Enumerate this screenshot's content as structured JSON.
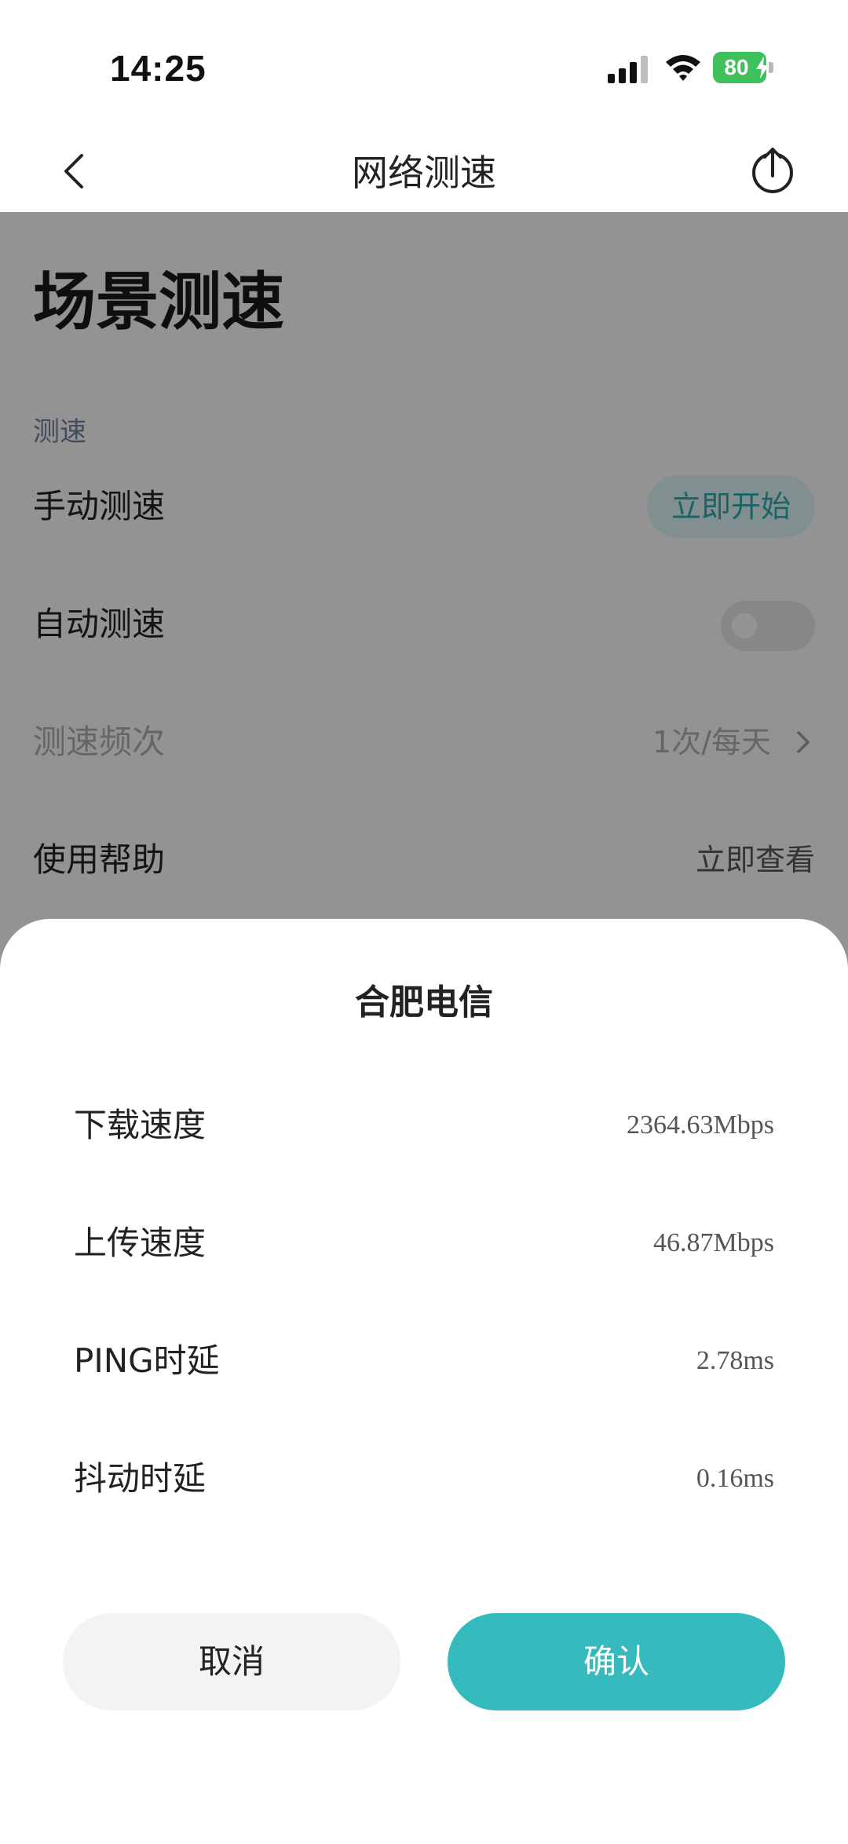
{
  "status_bar": {
    "time": "14:25",
    "battery": "80"
  },
  "nav": {
    "title": "网络测速",
    "back_icon": "chevron-left-icon",
    "share_icon": "share-upload-icon"
  },
  "page": {
    "title": "场景测速",
    "section": "测速",
    "rows": {
      "manual": {
        "label": "手动测速",
        "action": "立即开始"
      },
      "auto": {
        "label": "自动测速",
        "enabled": false
      },
      "frequency": {
        "label": "测速频次",
        "value": "1次/每天"
      },
      "help": {
        "label": "使用帮助",
        "value": "立即查看"
      }
    }
  },
  "sheet": {
    "title": "合肥电信",
    "metrics": [
      {
        "label": "下载速度",
        "value": "2364.63Mbps"
      },
      {
        "label": "上传速度",
        "value": "46.87Mbps"
      },
      {
        "label": "PING时延",
        "value": "2.78ms"
      },
      {
        "label": "抖动时延",
        "value": "0.16ms"
      }
    ],
    "cancel_label": "取消",
    "confirm_label": "确认"
  },
  "colors": {
    "accent": "#35babe",
    "battery": "#3ec15a",
    "overlay": "rgba(0,0,0,0.40)"
  }
}
